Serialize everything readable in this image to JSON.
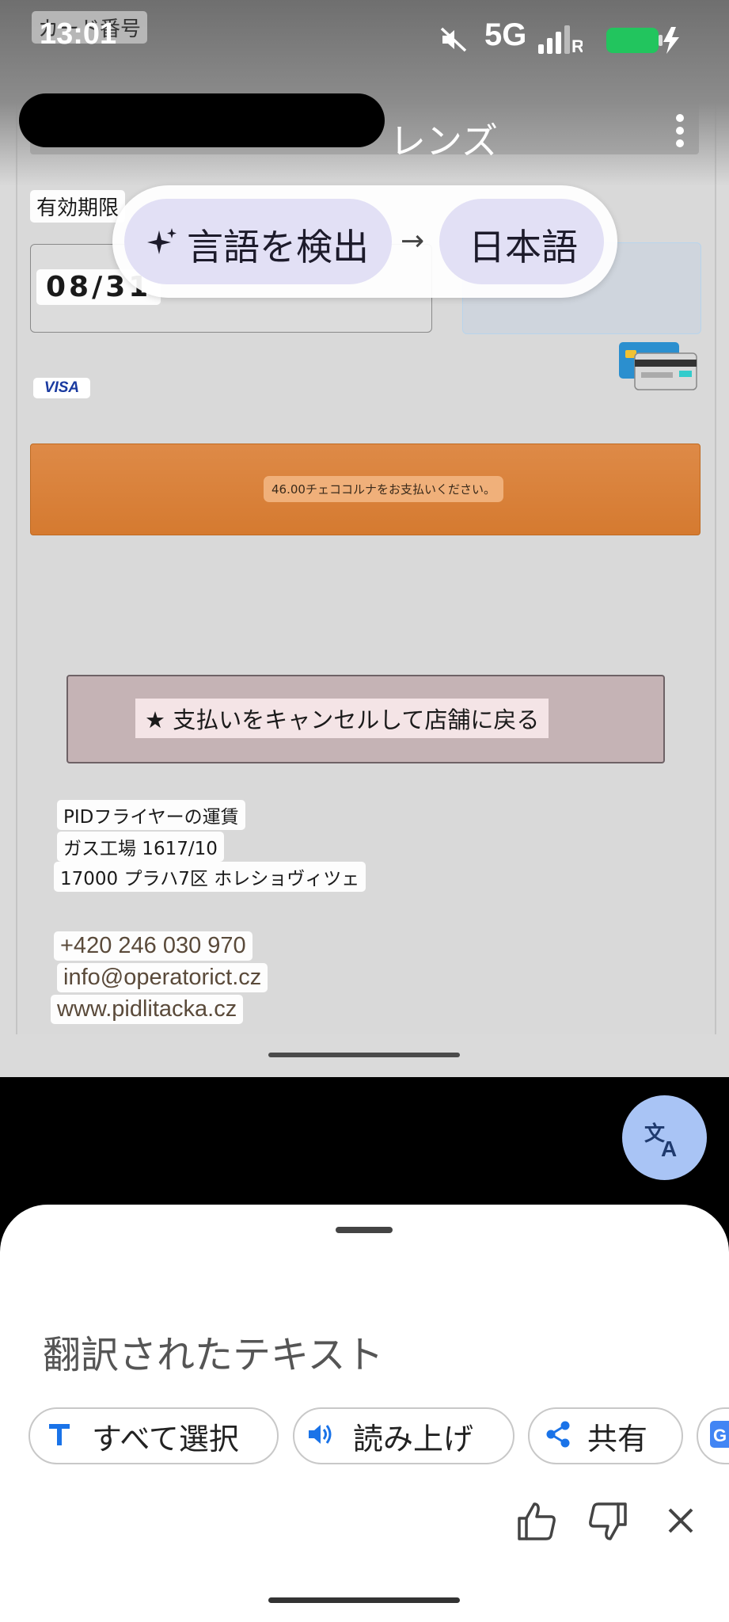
{
  "status_bar": {
    "time": "13:01",
    "network": "5G"
  },
  "app": {
    "title": "レンズ"
  },
  "page": {
    "card_number_label": "カード番号",
    "expiry_label": "有効期限",
    "expiry_value": "08/31",
    "card_brand": "VISA",
    "pay_button_text": "46.00チェココルナをお支払いください。",
    "cancel_button_text": "★ 支払いをキャンセルして店舗に戻る",
    "address": [
      "PIDフライヤーの運賃",
      "ガス工場 1617/10",
      "17000 プラハ7区 ホレショヴィツェ"
    ],
    "contact": {
      "phone": "+420 246 030 970",
      "email": "info@operatorict.cz",
      "website": "www.pidlitacka.cz"
    }
  },
  "language_bar": {
    "source": "言語を検出",
    "arrow": "→",
    "target": "日本語"
  },
  "bottom_sheet": {
    "heading": "翻訳されたテキスト",
    "actions": {
      "select_all": "すべて選択",
      "listen": "読み上げ",
      "share": "共有"
    }
  },
  "colors": {
    "pay_button": "#d57a30",
    "cancel_button": "#c5b3b5",
    "language_chip": "#e2e0f5",
    "translate_fab": "#a9c4f5",
    "action_icon_blue": "#1a73e8",
    "battery": "#22c55e"
  },
  "icons": [
    "mute-icon",
    "signal-icon",
    "battery-icon",
    "menu-icon",
    "sparkle-icon",
    "card-icon",
    "translate-icon",
    "text-select-icon",
    "speaker-icon",
    "share-icon",
    "google-icon",
    "thumbs-up-icon",
    "thumbs-down-icon",
    "close-icon"
  ]
}
